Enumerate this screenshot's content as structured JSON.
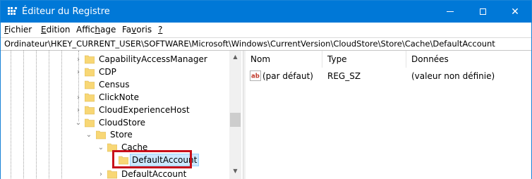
{
  "window": {
    "title": "Éditeur du Registre",
    "accent_color": "#0078d7",
    "app_icon": "registry-editor-icon",
    "caption_buttons": [
      "minimize",
      "maximize",
      "close"
    ],
    "close_glyph": "✕"
  },
  "menu": {
    "items": [
      {
        "pre": "",
        "ul": "F",
        "post": "ichier"
      },
      {
        "pre": "",
        "ul": "E",
        "post": "dition"
      },
      {
        "pre": "Affic",
        "ul": "h",
        "post": "age"
      },
      {
        "pre": "Fa",
        "ul": "v",
        "post": "oris"
      },
      {
        "pre": "",
        "ul": "?",
        "post": ""
      }
    ]
  },
  "address": "Ordinateur\\HKEY_CURRENT_USER\\SOFTWARE\\Microsoft\\Windows\\CurrentVersion\\CloudStore\\Store\\Cache\\DefaultAccount",
  "tree": {
    "nodes": [
      {
        "label": "CapabilityAccessManager",
        "expander": "›"
      },
      {
        "label": "CDP",
        "expander": "›"
      },
      {
        "label": "Census",
        "expander": ""
      },
      {
        "label": "ClickNote",
        "expander": "›"
      },
      {
        "label": "CloudExperienceHost",
        "expander": "›"
      },
      {
        "label": "CloudStore",
        "expander": "⌄"
      },
      {
        "label": "Store",
        "expander": "⌄"
      },
      {
        "label": "Cache",
        "expander": "⌄"
      },
      {
        "label": "DefaultAccount",
        "expander": "›",
        "selected": true
      },
      {
        "label": "DefaultAccount",
        "expander": "›"
      }
    ],
    "folder_color": "#f8d775",
    "selection_color": "#cce8ff",
    "highlight_color": "#c8101a",
    "scroll_up_glyph": "▲",
    "scroll_down_glyph": "▼"
  },
  "list": {
    "columns": [
      "Nom",
      "Type",
      "Données"
    ],
    "rows": [
      {
        "icon": "string-value-ab-icon",
        "icon_text": "ab",
        "name": "(par défaut)",
        "type": "REG_SZ",
        "data": "(valeur non définie)"
      }
    ]
  }
}
